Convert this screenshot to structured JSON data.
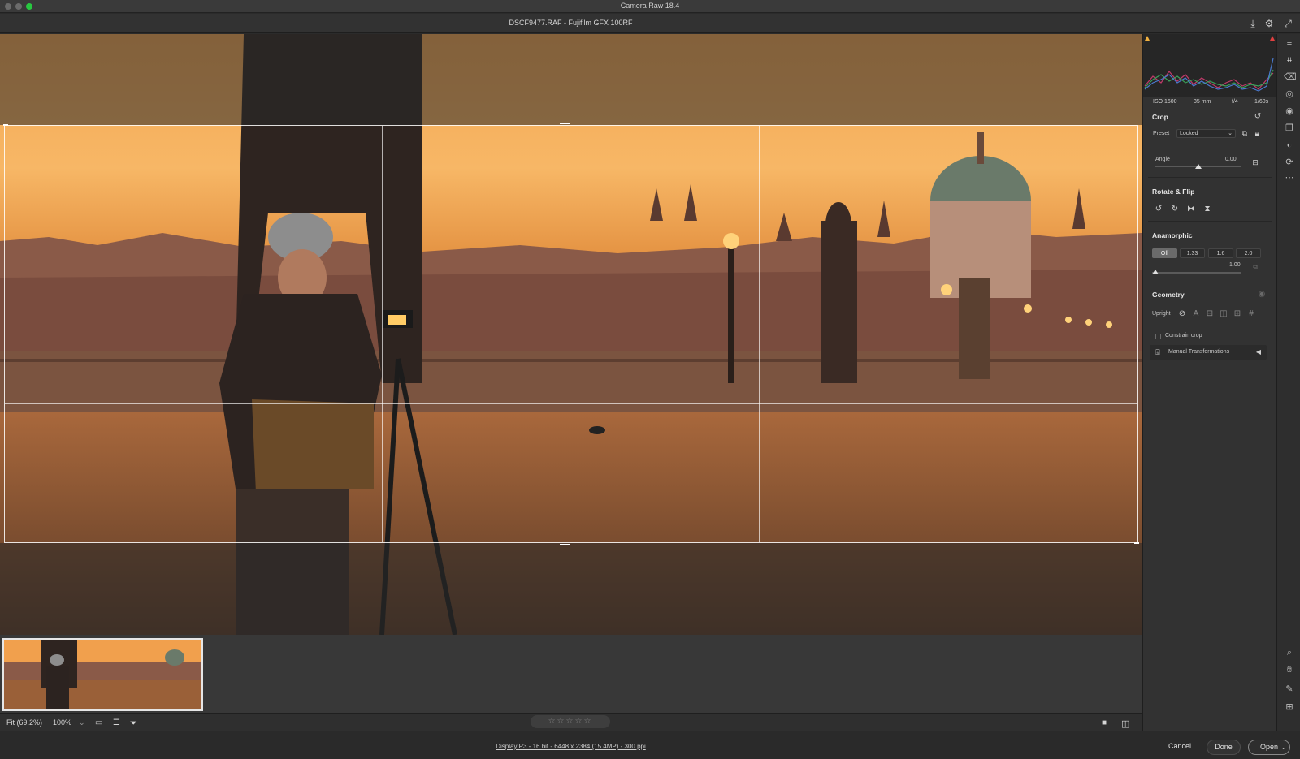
{
  "app": {
    "title": "Camera Raw 18.4"
  },
  "document": {
    "title": "DSCF9477.RAF  -  Fujifilm GFX 100RF"
  },
  "histogram": {
    "meta": {
      "iso": "ISO 1600",
      "focal": "35 mm",
      "aperture": "f/4",
      "shutter": "1/60s"
    }
  },
  "crop": {
    "title": "Crop",
    "preset_label": "Preset",
    "preset_value": "Locked",
    "angle_label": "Angle",
    "angle_value": "0.00"
  },
  "rotate": {
    "title": "Rotate & Flip"
  },
  "anamorphic": {
    "title": "Anamorphic",
    "options": [
      "Off",
      "1.33",
      "1.6",
      "2.0"
    ],
    "selected": "Off",
    "value": "1.00"
  },
  "geometry": {
    "title": "Geometry",
    "upright_label": "Upright",
    "constrain_label": "Constrain crop",
    "manual_label": "Manual Transformations"
  },
  "bottombar": {
    "zoom_fit": "Fit (69.2%)",
    "zoom_100": "100%",
    "rating": "☆☆☆☆☆"
  },
  "footer": {
    "info": "Display P3 - 16 bit - 6448 x 2384 (15.4MP) - 300 ppi",
    "cancel": "Cancel",
    "done": "Done",
    "open": "Open"
  },
  "colors": {
    "sky": "#f0a24a",
    "accent_green": "#28c840"
  }
}
